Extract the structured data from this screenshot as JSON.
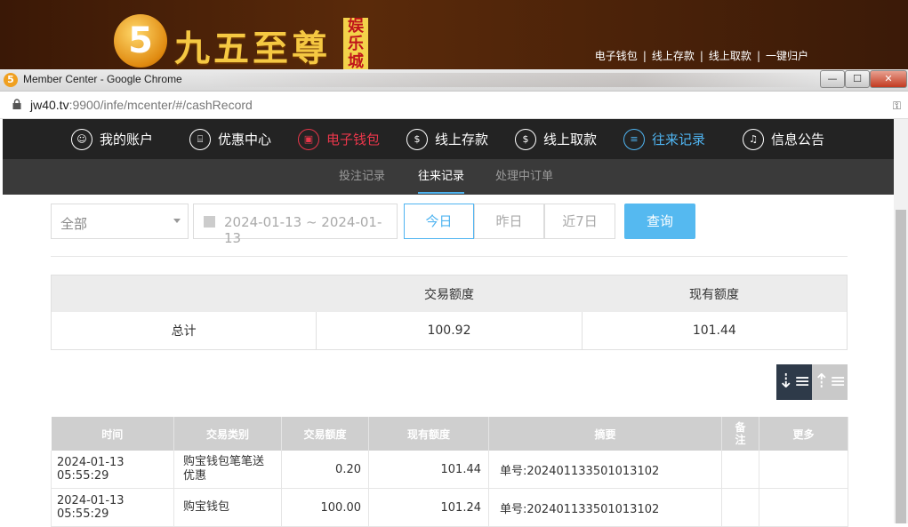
{
  "site": {
    "logo_mark": "5",
    "logo_text": "九五至尊",
    "logo_badge": "娱乐城",
    "top_links": [
      "电子钱包",
      "线上存款",
      "线上取款",
      "一键归户"
    ]
  },
  "browser": {
    "window_title": "Member Center - Google Chrome",
    "url_host": "jw40.tv",
    "url_rest": ":9900/infe/mcenter/#/cashRecord",
    "buttons": {
      "minimize": "—",
      "maximize": "☐",
      "close": "✕"
    }
  },
  "member_nav": {
    "items": [
      {
        "label": "我的账户",
        "icon": "user-icon",
        "state": "normal"
      },
      {
        "label": "优惠中心",
        "icon": "gift-icon",
        "state": "normal"
      },
      {
        "label": "电子钱包",
        "icon": "wallet-icon",
        "state": "highlight"
      },
      {
        "label": "线上存款",
        "icon": "deposit-icon",
        "state": "normal"
      },
      {
        "label": "线上取款",
        "icon": "withdraw-icon",
        "state": "normal"
      },
      {
        "label": "往来记录",
        "icon": "record-icon",
        "state": "active"
      },
      {
        "label": "信息公告",
        "icon": "bell-icon",
        "state": "normal"
      }
    ],
    "colors": {
      "highlight": "#e8364a",
      "active": "#4fb4f1"
    }
  },
  "sub_nav": {
    "items": [
      "投注记录",
      "往来记录",
      "处理中订单"
    ],
    "active_index": 1
  },
  "filters": {
    "type_value": "全部",
    "date_range": "2024-01-13 ~ 2024-01-13",
    "ranges": [
      "今日",
      "昨日",
      "近7日"
    ],
    "active_range": "今日",
    "query_label": "查询"
  },
  "summary": {
    "headers": [
      "",
      "交易额度",
      "现有额度"
    ],
    "row": [
      "总计",
      "100.92",
      "101.44"
    ]
  },
  "sort": {
    "desc_icon": "sort-desc-icon",
    "asc_icon": "sort-asc-icon"
  },
  "records": {
    "headers": [
      "时间",
      "交易类别",
      "交易额度",
      "现有额度",
      "摘要",
      "备注",
      "更多"
    ],
    "rows": [
      [
        "2024-01-13 05:55:29",
        "购宝钱包笔笔送优惠",
        "0.20",
        "101.44",
        "单号:202401133501013102",
        "",
        ""
      ],
      [
        "2024-01-13 05:55:29",
        "购宝钱包",
        "100.00",
        "101.24",
        "单号:202401133501013102",
        "",
        ""
      ]
    ]
  }
}
